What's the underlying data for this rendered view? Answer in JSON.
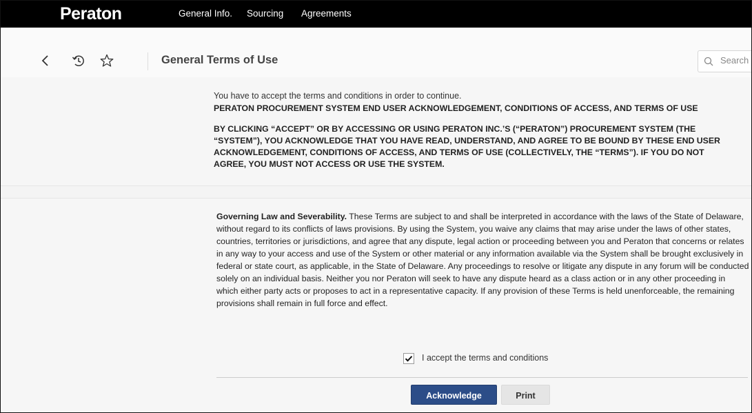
{
  "app": {
    "logo": "Peraton"
  },
  "topnav": {
    "items": [
      "General Info.",
      "Sourcing",
      "Agreements"
    ]
  },
  "toolbar": {
    "icons": [
      "back-arrow-icon",
      "history-icon",
      "star-icon"
    ],
    "title": "General Terms of Use",
    "search_placeholder": "Search"
  },
  "terms": {
    "intro": "You have to accept the terms and conditions in order to continue.",
    "heading": "PERATON PROCUREMENT SYSTEM END USER ACKNOWLEDGEMENT, CONDITIONS OF ACCESS, AND TERMS OF USE",
    "ack_paragraph": "BY CLICKING “ACCEPT” OR BY ACCESSING OR USING PERATON INC.’S (“PERATON”) PROCUREMENT SYSTEM (THE “SYSTEM”), YOU ACKNOWLEDGE THAT YOU HAVE READ, UNDERSTAND, AND AGREE TO BE BOUND BY THESE END USER ACKNOWLEDGEMENT, CONDITIONS OF ACCESS, AND TERMS OF USE (COLLECTIVELY, THE “TERMS”). IF YOU DO NOT AGREE, YOU MUST NOT ACCESS OR USE THE SYSTEM.",
    "law_title": "Governing Law and Severability.",
    "law_body": " These Terms are subject to and shall be interpreted in accordance with the laws of the State of Delaware, without regard to its conflicts of laws provisions. By using the System, you waive any claims that may arise under the laws of other states, countries, territories or jurisdictions, and agree that any dispute, legal action or proceeding between you and Peraton that concerns or relates in any way to your access and use of the System or other material or any information available via the System shall be brought exclusively in federal or state court, as applicable, in the State of Delaware. Any proceedings to resolve or litigate any dispute in any forum will be conducted solely on an individual basis. Neither you nor Peraton will seek to have any dispute heard as a class action or in any other proceeding in which either party acts or proposes to act in a representative capacity. If any provision of these Terms is held unenforceable, the remaining provisions shall remain in full force and effect."
  },
  "accept": {
    "label": "I accept the terms and conditions",
    "checked": true
  },
  "actions": {
    "primary": "Acknowledge",
    "secondary": "Print"
  },
  "colors": {
    "topbar": "#000000",
    "primary_button": "#2c4d88"
  }
}
